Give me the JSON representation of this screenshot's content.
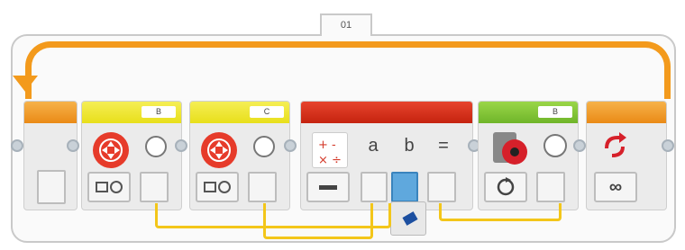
{
  "loop": {
    "label": "01",
    "mode_icon": "infinity-icon"
  },
  "blocks": [
    {
      "name": "loop-start",
      "color": "#ea8a16"
    },
    {
      "name": "large-motor-b",
      "port": "B",
      "color": "#e8df1a",
      "icon": "steering-wheel-icon",
      "mode_icon": "motor-on-icon"
    },
    {
      "name": "large-motor-c",
      "port": "C",
      "color": "#e8df1a",
      "icon": "steering-wheel-icon",
      "mode_icon": "motor-on-icon"
    },
    {
      "name": "math-block",
      "color": "#c5230f",
      "icon": "math-ops-icon",
      "mode_icon": "minus-icon",
      "a_label": "a",
      "b_label": "b",
      "equals": "="
    },
    {
      "name": "motor-rotation-sensor-b",
      "port": "B",
      "color": "#6fb52a",
      "icon": "rotation-sensor-icon",
      "mode_icon": "reset-icon"
    },
    {
      "name": "loop-end",
      "color": "#ea8a16",
      "icon": "loop-arrow-icon"
    }
  ]
}
